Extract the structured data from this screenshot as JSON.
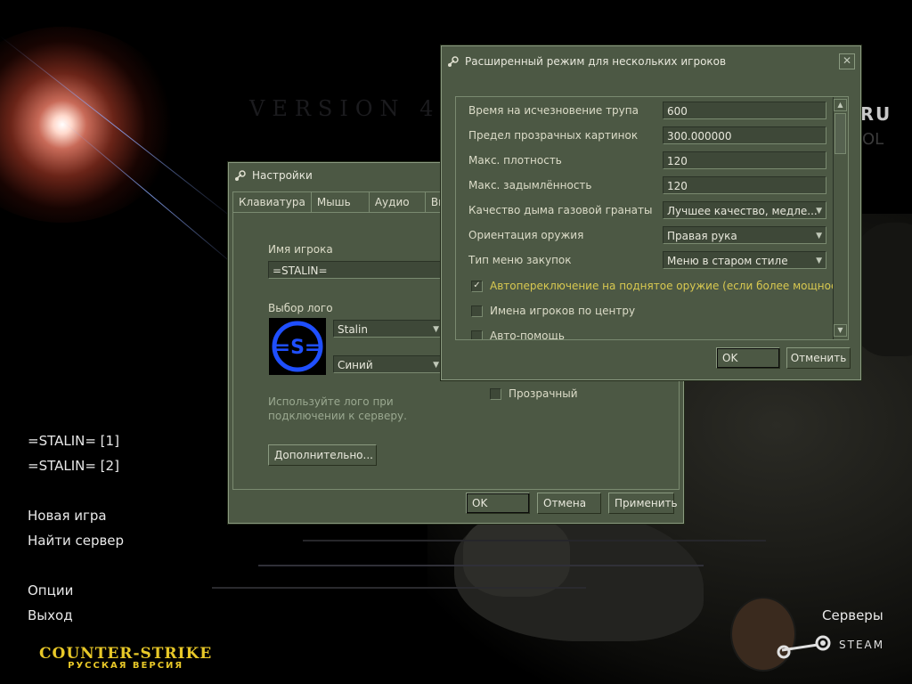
{
  "background": {
    "watermark_version": "VERSION 4.",
    "site_suffix": ".RU",
    "site_suffix2": "OL"
  },
  "main_menu": {
    "recent_servers": [
      "=STALIN= [1]",
      "=STALIN= [2]"
    ],
    "new_game": "Новая игра",
    "find_server": "Найти сервер",
    "options": "Опции",
    "quit": "Выход",
    "servers": "Серверы",
    "steam": "STEAM"
  },
  "game_logo": {
    "line1": "COUNTER-STRIKE",
    "line2": "РУССКАЯ ВЕРСИЯ"
  },
  "settings_dialog": {
    "title": "Настройки",
    "tabs": [
      "Клавиатура",
      "Мышь",
      "Аудио",
      "Ви"
    ],
    "player_name_label": "Имя игрока",
    "player_name_value": "=STALIN=",
    "logo_label": "Выбор лого",
    "logo_select_value": "Stalin",
    "logo_color_value": "Синий",
    "logo_text": "=S=",
    "hint_line1": "Используйте лого при",
    "hint_line2": "подключении к серверу.",
    "advanced_button": "Дополнительно...",
    "transparent_label": "Прозрачный",
    "transparent_checked": false,
    "ok": "OK",
    "cancel": "Отмена",
    "apply": "Применить"
  },
  "advanced_dialog": {
    "title": "Расширенный режим для нескольких игроков",
    "close": "✕",
    "fields": [
      {
        "label": "Время на исчезновение трупа",
        "value": "600"
      },
      {
        "label": "Предел прозрачных картинок",
        "value": "300.000000"
      },
      {
        "label": "Макс. плотность",
        "value": "120"
      },
      {
        "label": "Макс. задымлённость",
        "value": "120"
      }
    ],
    "combos": [
      {
        "label": "Качество дыма газовой гранаты",
        "value": "Лучшее качество, медле..."
      },
      {
        "label": "Ориентация оружия",
        "value": "Правая рука"
      },
      {
        "label": "Тип меню закупок",
        "value": "Меню в старом стиле"
      }
    ],
    "checkboxes": [
      {
        "label": "Автопереключение на поднятое оружие (если более мощное)",
        "checked": true
      },
      {
        "label": "Имена игроков по центру",
        "checked": false
      },
      {
        "label": "Авто-помощь",
        "checked": false
      }
    ],
    "ok": "OK",
    "cancel": "Отменить"
  },
  "colors": {
    "dialog_bg": "#4c5844",
    "highlight_text": "#d8c850",
    "logo_blue": "#1f4fff"
  }
}
